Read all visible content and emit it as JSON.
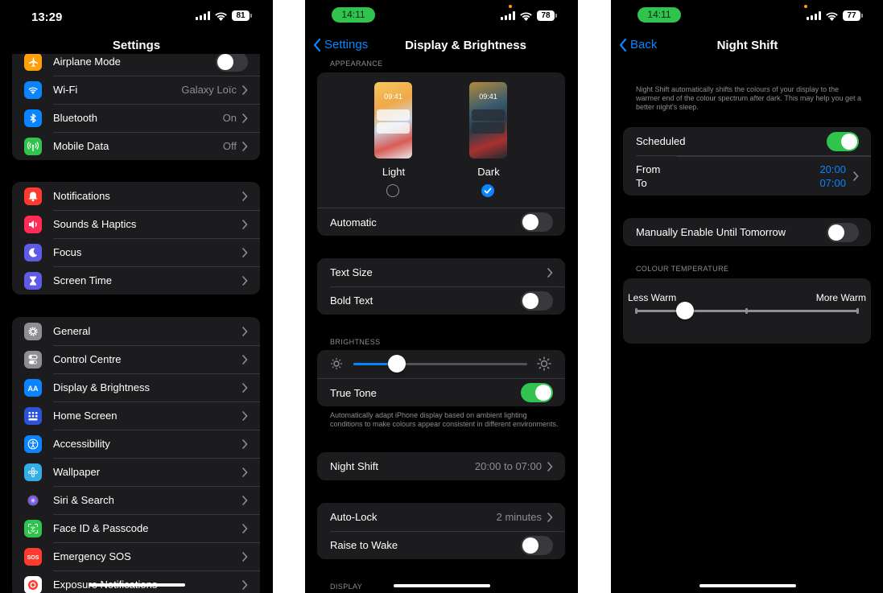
{
  "screen1": {
    "status": {
      "time": "13:29",
      "battery": "81"
    },
    "title": "Settings",
    "group1": [
      {
        "label": "Airplane Mode",
        "icon": "airplane-icon",
        "color": "#ff9f0a",
        "type": "toggle",
        "on": false
      },
      {
        "label": "Wi-Fi",
        "icon": "wifi-icon",
        "color": "#0a84ff",
        "value": "Galaxy Loïc"
      },
      {
        "label": "Bluetooth",
        "icon": "bluetooth-icon",
        "color": "#0a84ff",
        "value": "On"
      },
      {
        "label": "Mobile Data",
        "icon": "antenna-icon",
        "color": "#30c34e",
        "value": "Off"
      }
    ],
    "group2": [
      {
        "label": "Notifications",
        "icon": "bell-icon",
        "color": "#ff3b30"
      },
      {
        "label": "Sounds & Haptics",
        "icon": "speaker-icon",
        "color": "#ff2d55"
      },
      {
        "label": "Focus",
        "icon": "moon-icon",
        "color": "#5e5ce6"
      },
      {
        "label": "Screen Time",
        "icon": "hourglass-icon",
        "color": "#5e5ce6"
      }
    ],
    "group3": [
      {
        "label": "General",
        "icon": "gear-icon",
        "color": "#8e8e93"
      },
      {
        "label": "Control Centre",
        "icon": "switches-icon",
        "color": "#8e8e93"
      },
      {
        "label": "Display & Brightness",
        "icon": "aa-icon",
        "color": "#0a84ff"
      },
      {
        "label": "Home Screen",
        "icon": "grid-icon",
        "color": "#2c53d6"
      },
      {
        "label": "Accessibility",
        "icon": "accessibility-icon",
        "color": "#0a84ff"
      },
      {
        "label": "Wallpaper",
        "icon": "flower-icon",
        "color": "#32ade6"
      },
      {
        "label": "Siri & Search",
        "icon": "siri-icon",
        "color": "#1c1c1e"
      },
      {
        "label": "Face ID & Passcode",
        "icon": "faceid-icon",
        "color": "#30c34e"
      },
      {
        "label": "Emergency SOS",
        "icon": "sos-icon",
        "color": "#ff3b30"
      },
      {
        "label": "Exposure Notifications",
        "icon": "exposure-icon",
        "color": "#ffffff"
      }
    ]
  },
  "screen2": {
    "status": {
      "time": "14:11",
      "battery": "78"
    },
    "back_label": "Settings",
    "title": "Display & Brightness",
    "appearance_header": "APPEARANCE",
    "light": {
      "label": "Light",
      "preview_time": "09:41",
      "selected": false
    },
    "dark": {
      "label": "Dark",
      "preview_time": "09:41",
      "selected": true
    },
    "automatic_label": "Automatic",
    "automatic_on": false,
    "text_size_label": "Text Size",
    "bold_text_label": "Bold Text",
    "bold_text_on": false,
    "brightness_header": "BRIGHTNESS",
    "brightness_level": 0.25,
    "true_tone_label": "True Tone",
    "true_tone_on": true,
    "true_tone_footnote": "Automatically adapt iPhone display based on ambient lighting conditions to make colours appear consistent in different environments.",
    "night_shift_label": "Night Shift",
    "night_shift_value": "20:00 to 07:00",
    "auto_lock_label": "Auto-Lock",
    "auto_lock_value": "2 minutes",
    "raise_to_wake_label": "Raise to Wake",
    "raise_to_wake_on": false,
    "display_header": "DISPLAY"
  },
  "screen3": {
    "status": {
      "time": "14:11",
      "battery": "77"
    },
    "back_label": "Back",
    "title": "Night Shift",
    "description": "Night Shift automatically shifts the colours of your display to the warmer end of the colour spectrum after dark. This may help you get a better night's sleep.",
    "scheduled_label": "Scheduled",
    "scheduled_on": true,
    "from_label": "From",
    "to_label": "To",
    "from_value": "20:00",
    "to_value": "07:00",
    "manual_label": "Manually Enable Until Tomorrow",
    "manual_on": false,
    "temperature_header": "COLOUR TEMPERATURE",
    "less_warm_label": "Less Warm",
    "more_warm_label": "More Warm",
    "temperature_level": 0.22
  },
  "colors": {
    "accent": "#0a84ff",
    "toggle_on": "#30c34e",
    "cell": "#1c1c1e",
    "secondary_text": "#8e8e93"
  }
}
